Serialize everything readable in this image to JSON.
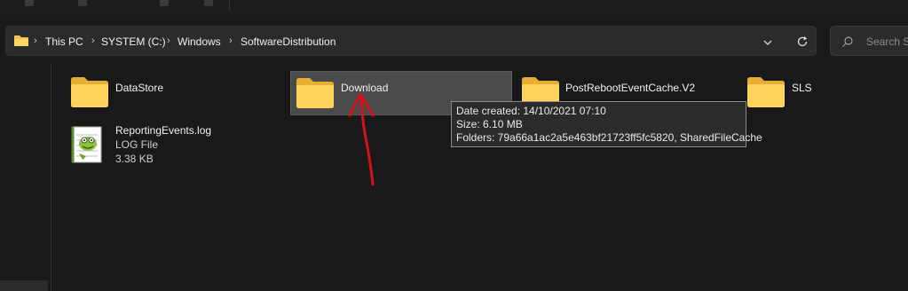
{
  "address_bar": {
    "breadcrumbs": [
      "This PC",
      "SYSTEM (C:)",
      "Windows",
      "SoftwareDistribution"
    ]
  },
  "search": {
    "placeholder": "Search So"
  },
  "items": [
    {
      "name": "DataStore",
      "type": "folder"
    },
    {
      "name": "Download",
      "type": "folder",
      "selected": true
    },
    {
      "name": "PostRebootEventCache.V2",
      "type": "folder"
    },
    {
      "name": "SLS",
      "type": "folder"
    },
    {
      "name": "ReportingEvents.log",
      "type": "file",
      "kind": "LOG File",
      "size": "3.38 KB"
    }
  ],
  "tooltip": {
    "date_created": "Date created: 14/10/2021 07:10",
    "size": "Size: 6.10 MB",
    "folders": "Folders: 79a66a1ac2a5e463bf21723ff5fc5820, SharedFileCache"
  },
  "colors": {
    "background": "#191919",
    "folder": "#f5c54a",
    "annotation_arrow": "#d3121b",
    "selection": "#4a4a4a"
  }
}
